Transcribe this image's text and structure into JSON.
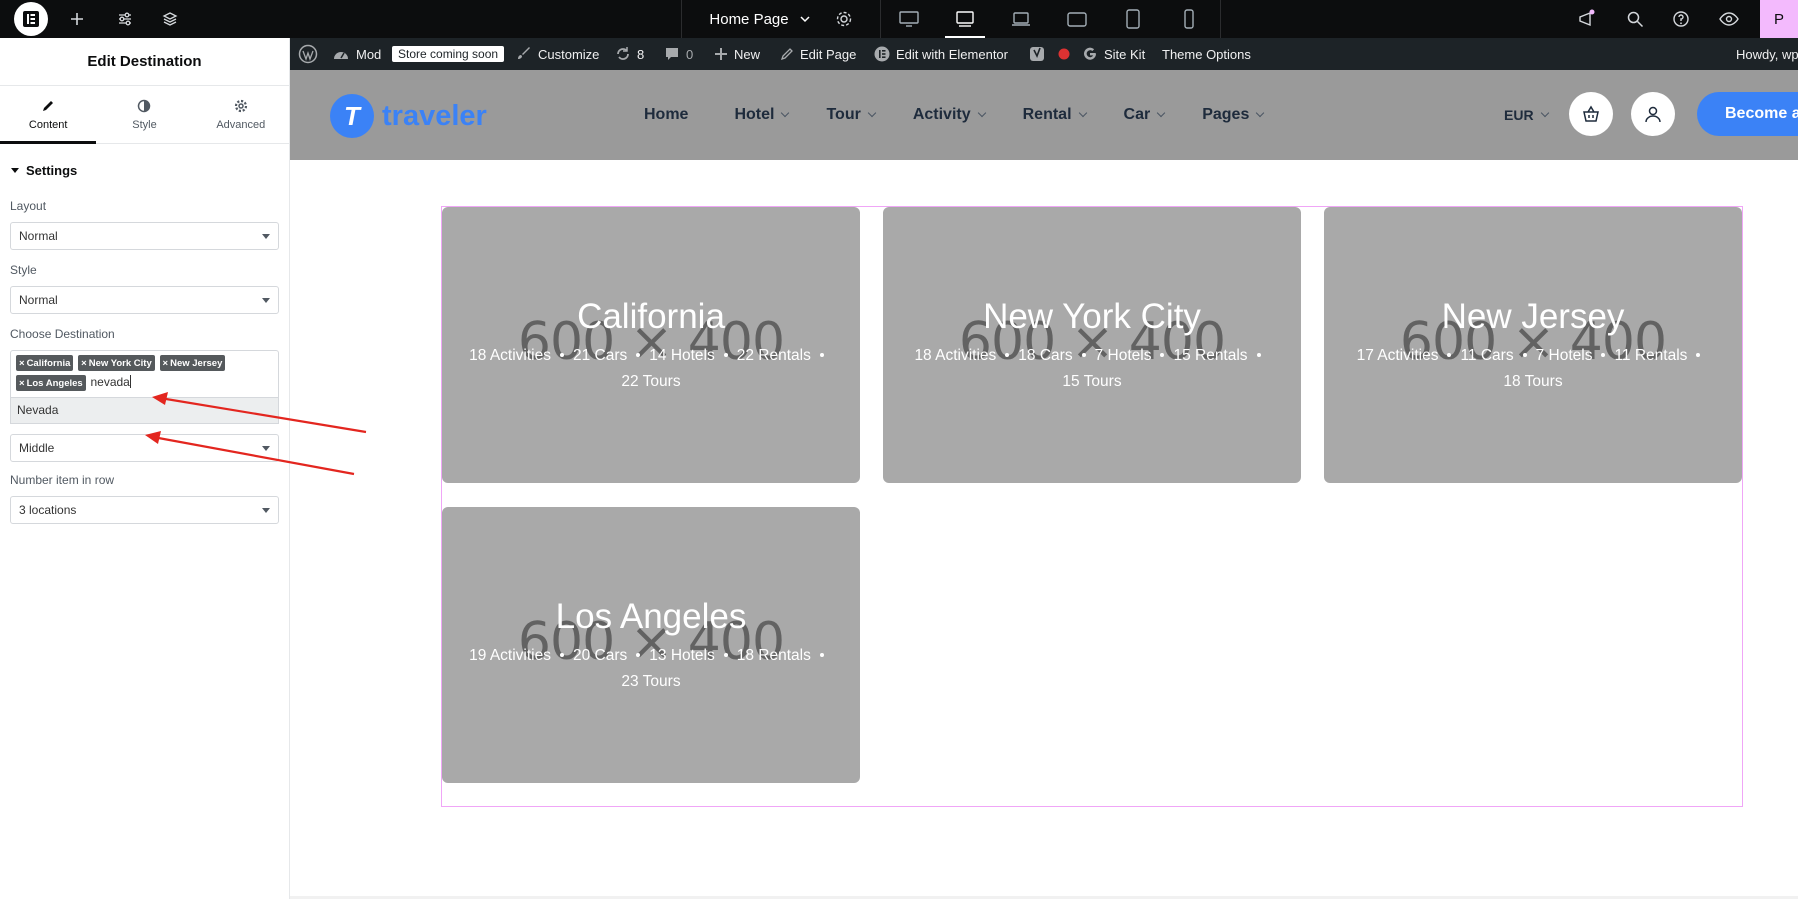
{
  "topbar": {
    "page_name": "Home Page",
    "publish_label": "P"
  },
  "panel": {
    "title": "Edit Destination",
    "tabs": [
      {
        "label": "Content",
        "icon": "pencil-icon"
      },
      {
        "label": "Style",
        "icon": "half-circle-icon"
      },
      {
        "label": "Advanced",
        "icon": "gear-icon"
      }
    ],
    "section_title": "Settings",
    "layout_label": "Layout",
    "layout_value": "Normal",
    "style_label": "Style",
    "style_value": "Normal",
    "choose_label": "Choose Destination",
    "tags": [
      "California",
      "New York City",
      "New Jersey",
      "Los Angeles"
    ],
    "typed_text": "nevada",
    "suggestion": "Nevada",
    "align_value": "Middle",
    "items_label": "Number item in row",
    "items_value": "3 locations"
  },
  "adminbar": {
    "site_short": "Mod",
    "store_badge": "Store coming soon",
    "customize": "Customize",
    "updates": "8",
    "comments": "0",
    "new": "New",
    "edit_page": "Edit Page",
    "edit_elementor": "Edit with Elementor",
    "site_kit": "Site Kit",
    "theme_options": "Theme Options",
    "howdy": "Howdy, wp"
  },
  "header": {
    "brand_mark": "T",
    "brand_text": "traveler",
    "nav": [
      "Home",
      "Hotel",
      "Tour",
      "Activity",
      "Rental",
      "Car",
      "Pages"
    ],
    "currency": "EUR",
    "become_label": "Become a"
  },
  "cards": [
    {
      "title": "California",
      "placeholder": "600 × 400",
      "meta_line1": [
        "18 Activities",
        "21 Cars",
        "14 Hotels",
        "22 Rentals"
      ],
      "meta_line2": "22 Tours"
    },
    {
      "title": "New York City",
      "placeholder": "600 × 400",
      "meta_line1": [
        "18 Activities",
        "18 Cars",
        "7 Hotels",
        "15 Rentals"
      ],
      "meta_line2": "15 Tours"
    },
    {
      "title": "New Jersey",
      "placeholder": "600 × 400",
      "meta_line1": [
        "17 Activities",
        "11 Cars",
        "7 Hotels",
        "11 Rentals"
      ],
      "meta_line2": "18 Tours"
    },
    {
      "title": "Los Angeles",
      "placeholder": "600 × 400",
      "meta_line1": [
        "19 Activities",
        "20 Cars",
        "13 Hotels",
        "18 Rentals"
      ],
      "meta_line2": "23 Tours"
    }
  ],
  "colors": {
    "accent": "#3b82f6",
    "annotation": "#e3261f",
    "outline": "#f0a6f7"
  }
}
